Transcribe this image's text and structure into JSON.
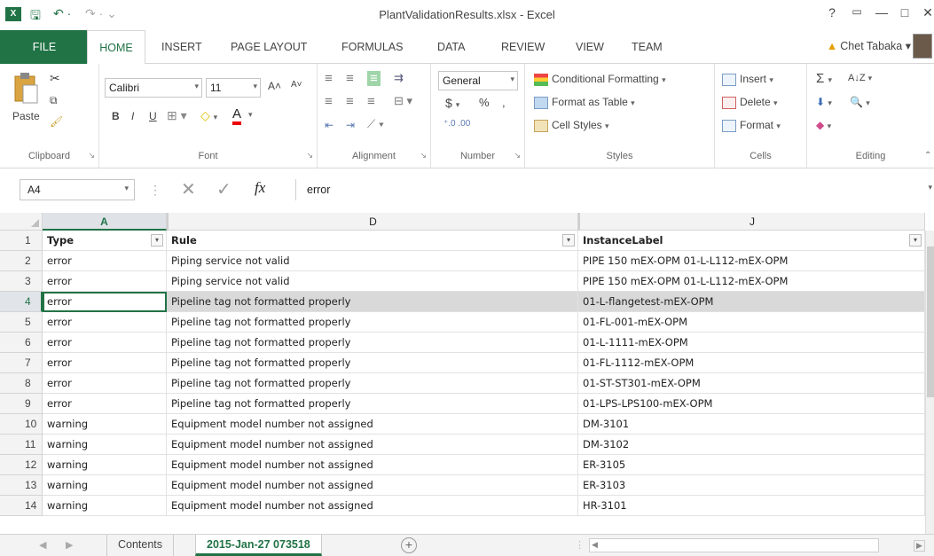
{
  "window": {
    "title": "PlantValidationResults.xlsx - Excel",
    "help": "?",
    "minimize": "—",
    "restore": "□",
    "close": "✕"
  },
  "quick_access": {
    "save": "🖫",
    "undo": "↶ ·",
    "redo": "↷ · ⌄"
  },
  "tabs": [
    "FILE",
    "HOME",
    "INSERT",
    "PAGE LAYOUT",
    "FORMULAS",
    "DATA",
    "REVIEW",
    "VIEW",
    "TEAM"
  ],
  "user": {
    "name": "Chet Tabaka",
    "chevron": "▾"
  },
  "ribbon": {
    "clipboard": {
      "label": "Clipboard",
      "paste": "Paste"
    },
    "font": {
      "label": "Font",
      "name": "Calibri",
      "size": "11",
      "bold": "B",
      "italic": "I",
      "underline": "U",
      "grow": "A˄",
      "shrink": "A˅"
    },
    "alignment": {
      "label": "Alignment"
    },
    "number": {
      "label": "Number",
      "format": "General",
      "currency": "$",
      "percent": "%",
      "comma": ",",
      "inc_dec": "⁺⁰.₀₀",
      "dec_dec": "⁰⁰.₀"
    },
    "styles": {
      "label": "Styles",
      "conditional": "Conditional Formatting",
      "table": "Format as Table",
      "cell_styles": "Cell Styles"
    },
    "cells": {
      "label": "Cells",
      "insert": "Insert",
      "delete": "Delete",
      "format": "Format"
    },
    "editing": {
      "label": "Editing",
      "sum": "Σ",
      "sort": "A↓Z",
      "find": "🔍",
      "fill": "⬇",
      "clear": "◆"
    },
    "collapse": "⌃"
  },
  "formula_bar": {
    "name_box": "A4",
    "cancel": "✕",
    "enter": "✓",
    "fx": "fx",
    "value": "error"
  },
  "columns": [
    {
      "letter": "A",
      "header": "Type",
      "selected": true
    },
    {
      "letter": "D",
      "header": "Rule",
      "selected": false
    },
    {
      "letter": "J",
      "header": "InstanceLabel",
      "selected": false
    }
  ],
  "rows": [
    {
      "num": "2",
      "type": "error",
      "rule": "Piping service not valid",
      "label": "PIPE 150 mEX-OPM 01-L-L112-mEX-OPM"
    },
    {
      "num": "3",
      "type": "error",
      "rule": "Piping service not valid",
      "label": "PIPE 150 mEX-OPM 01-L-L112-mEX-OPM"
    },
    {
      "num": "4",
      "type": "error",
      "rule": "Pipeline tag not formatted properly",
      "label": "01-L-flangetest-mEX-OPM"
    },
    {
      "num": "5",
      "type": "error",
      "rule": "Pipeline tag not formatted properly",
      "label": "01-FL-001-mEX-OPM"
    },
    {
      "num": "6",
      "type": "error",
      "rule": "Pipeline tag not formatted properly",
      "label": "01-L-1111-mEX-OPM"
    },
    {
      "num": "7",
      "type": "error",
      "rule": "Pipeline tag not formatted properly",
      "label": "01-FL-1112-mEX-OPM"
    },
    {
      "num": "8",
      "type": "error",
      "rule": "Pipeline tag not formatted properly",
      "label": "01-ST-ST301-mEX-OPM"
    },
    {
      "num": "9",
      "type": "error",
      "rule": "Pipeline tag not formatted properly",
      "label": "01-LPS-LPS100-mEX-OPM"
    },
    {
      "num": "10",
      "type": "warning",
      "rule": "Equipment model number not assigned",
      "label": "DM-3101"
    },
    {
      "num": "11",
      "type": "warning",
      "rule": "Equipment model number not assigned",
      "label": "DM-3102"
    },
    {
      "num": "12",
      "type": "warning",
      "rule": "Equipment model number not assigned",
      "label": "ER-3105"
    },
    {
      "num": "13",
      "type": "warning",
      "rule": "Equipment model number not assigned",
      "label": "ER-3103"
    },
    {
      "num": "14",
      "type": "warning",
      "rule": "Equipment model number not assigned",
      "label": "HR-3101"
    }
  ],
  "header_row_num": "1",
  "sheets": [
    "Contents",
    "2015-Jan-27 073518"
  ],
  "add_sheet": "+",
  "nav": {
    "prev": "◀",
    "next": "▶",
    "hs_left": "◀",
    "hs_right": "▶"
  },
  "colors": {
    "accent": "#217346",
    "selected_row": "#d9d9d9"
  }
}
